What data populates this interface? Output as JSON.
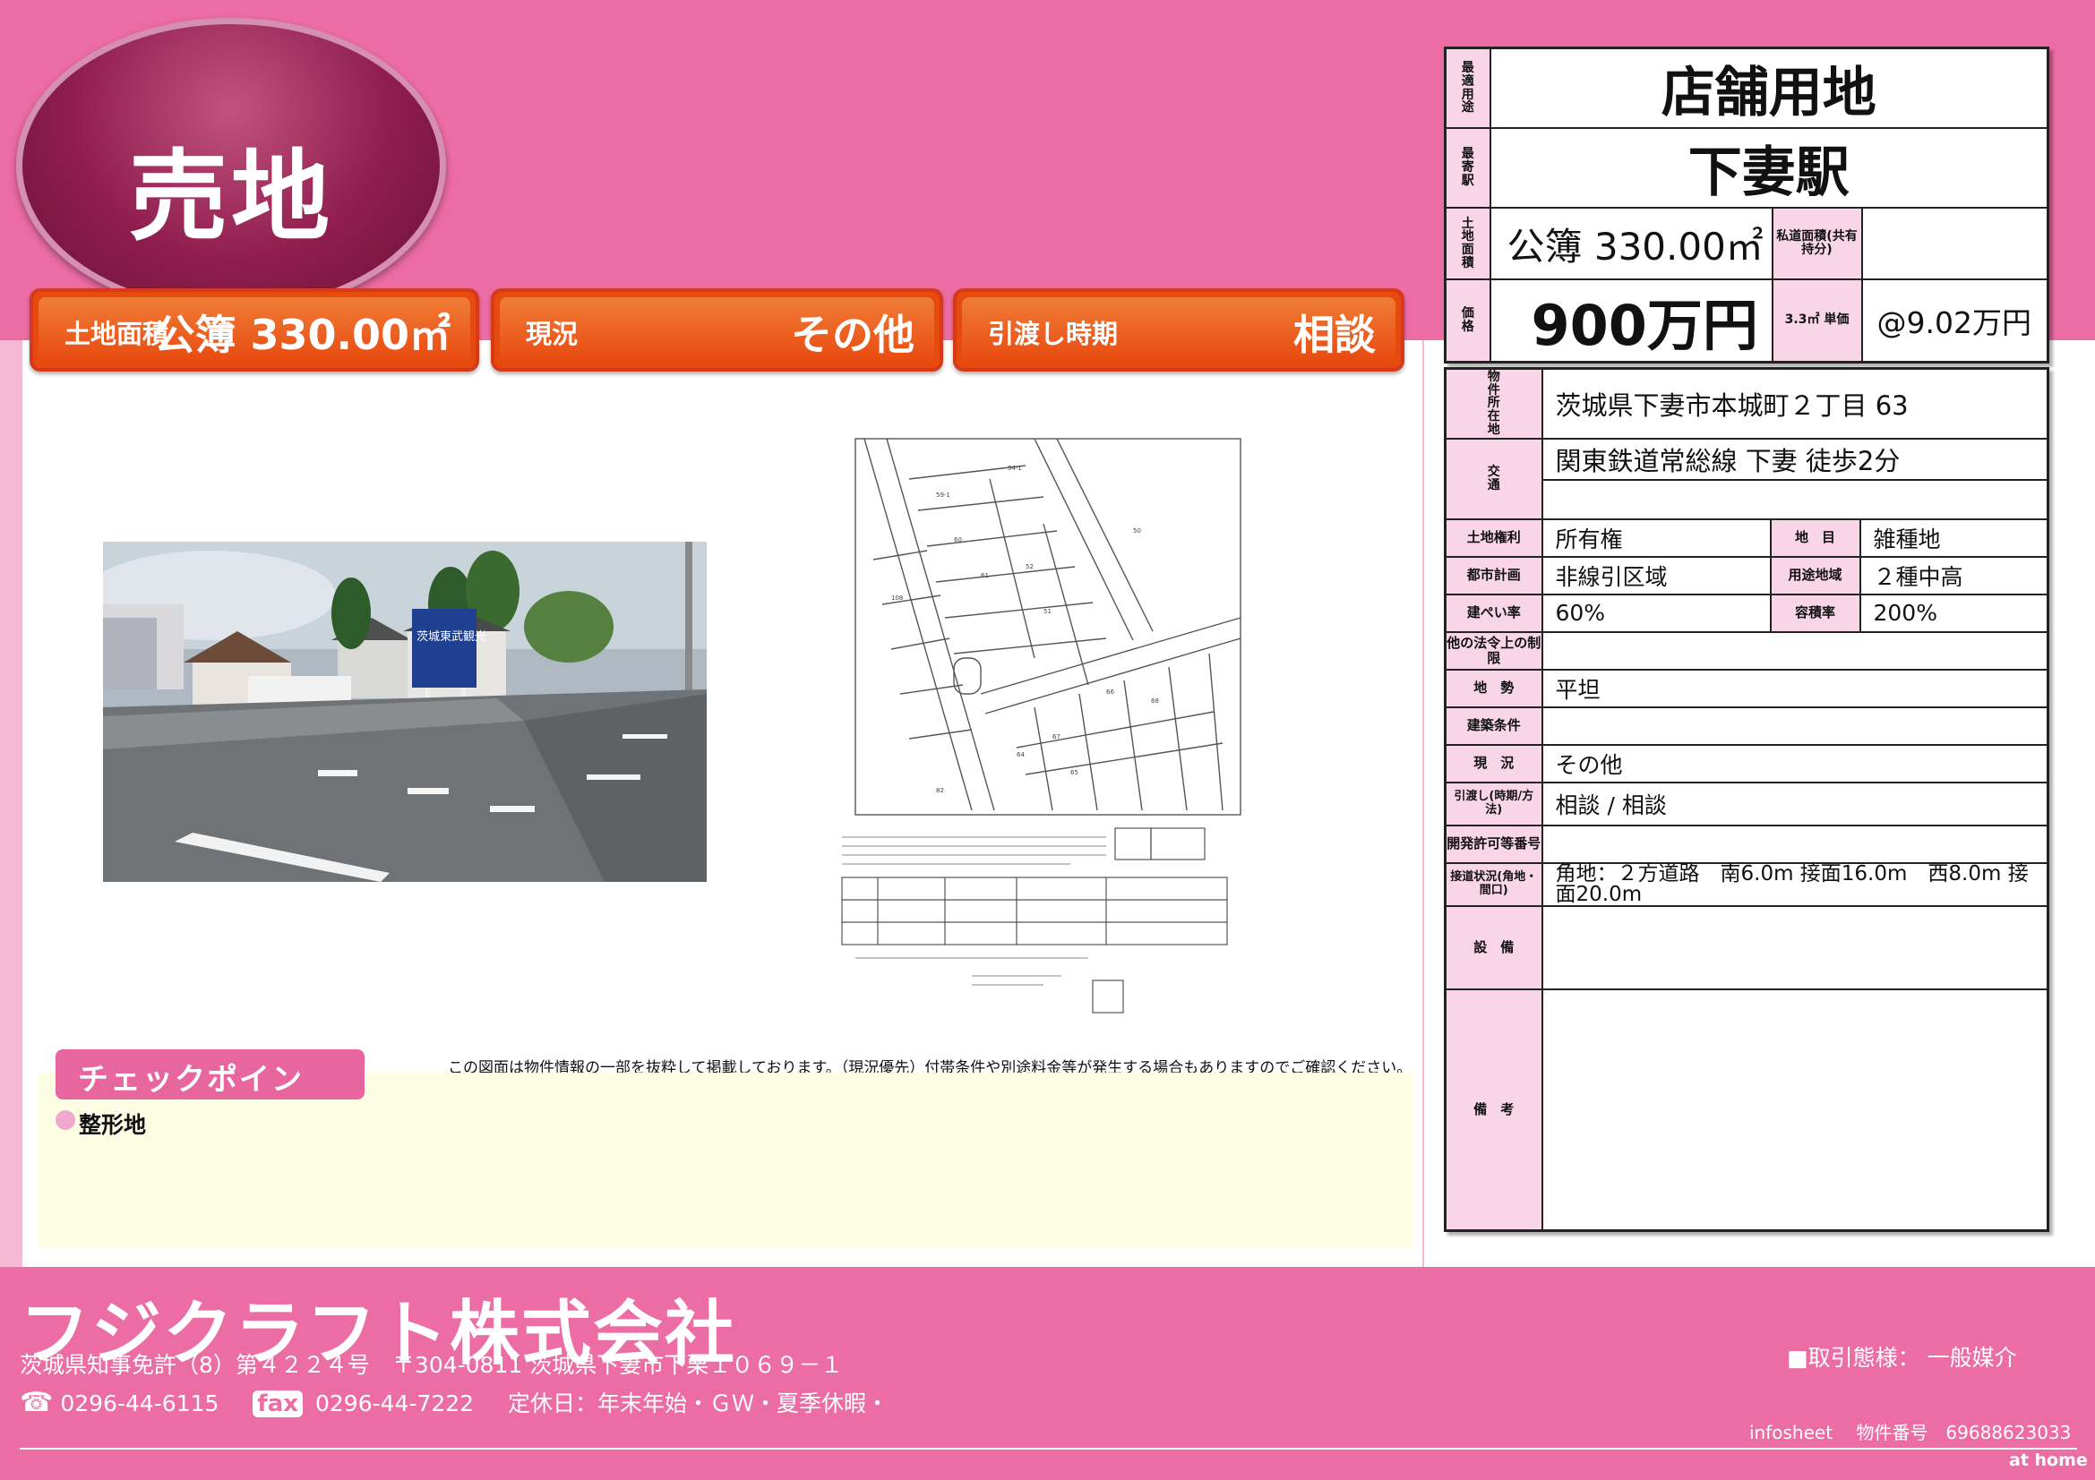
{
  "sale_type": "売地",
  "highlights": [
    {
      "label": "土地面積",
      "value": "公簿 330.00㎡"
    },
    {
      "label": "現況",
      "value": "その他"
    },
    {
      "label": "引渡し時期",
      "value": "相談"
    }
  ],
  "summary": {
    "use_label": "最適用途",
    "use_value": "店舗用地",
    "station_label": "最寄駅",
    "station_value": "下妻駅",
    "area_label": "土地面積",
    "area_value": "公簿 330.00㎡",
    "private_road_label": "私道面積(共有持分)",
    "private_road_value": "",
    "price_label": "価格",
    "price_value": "900万円",
    "unit_label": "3.3㎡ 単価",
    "unit_value": "@9.02万円"
  },
  "details": {
    "location_label": "物件所在地",
    "location_value": "茨城県下妻市本城町２丁目 63",
    "transport_label": "交通",
    "transport_value": "関東鉄道常総線 下妻 徒歩2分",
    "transport_value2": "",
    "rows": [
      {
        "label": "土地権利",
        "value": "所有権",
        "label2": "地　目",
        "value2": "雑種地"
      },
      {
        "label": "都市計画",
        "value": "非線引区域",
        "label2": "用途地域",
        "value2": "２種中高"
      },
      {
        "label": "建ぺい率",
        "value": "60%",
        "label2": "容積率",
        "value2": "200%"
      }
    ],
    "other_law_label": "他の法令上の制限",
    "other_law_value": "",
    "terrain_label": "地　勢",
    "terrain_value": "平坦",
    "building_cond_label": "建築条件",
    "building_cond_value": "",
    "status_label": "現　況",
    "status_value": "その他",
    "handover_label": "引渡し(時期/方法)",
    "handover_value": "相談 / 相談",
    "dev_permit_label": "開発許可等番号",
    "dev_permit_value": "",
    "road_label": "接道状況(角地・間口)",
    "road_value": "角地：２方道路　南6.0m 接面16.0m　西8.0m 接面20.0m",
    "facilities_label": "設　備",
    "facilities_value": "",
    "remarks_label": "備　考",
    "remarks_value": ""
  },
  "disclaimer": "この図面は物件情報の一部を抜粋して掲載しております。（現況優先）付帯条件や別途料金等が発生する場合もありますのでご確認ください。",
  "checkpoint": {
    "title": "チェックポイント！",
    "items": [
      "整形地"
    ]
  },
  "photo_sign_text": "茨城東武観光",
  "footer": {
    "company": "フジクラフト株式会社",
    "license": "茨城県知事免許（8）第４２２４号　〒304-0811 茨城県下妻市下栗１０６９－１",
    "tel_label": "☎",
    "tel": "0296-44-6115",
    "fax_label": "fax",
    "fax": "0296-44-7222",
    "holiday": "定休日：年末年始・ＧＷ・夏季休暇・",
    "trade_type": "■取引態様：  一般媒介",
    "infosheet": "infosheet　 物件番号　69688623033",
    "brand": "at home"
  },
  "colors": {
    "pink": "#ec6ca4",
    "orange": "#e84a10",
    "label_bg": "#f9d6e7",
    "check_bg": "#fdfde3",
    "oval": "#8e1d4d"
  }
}
